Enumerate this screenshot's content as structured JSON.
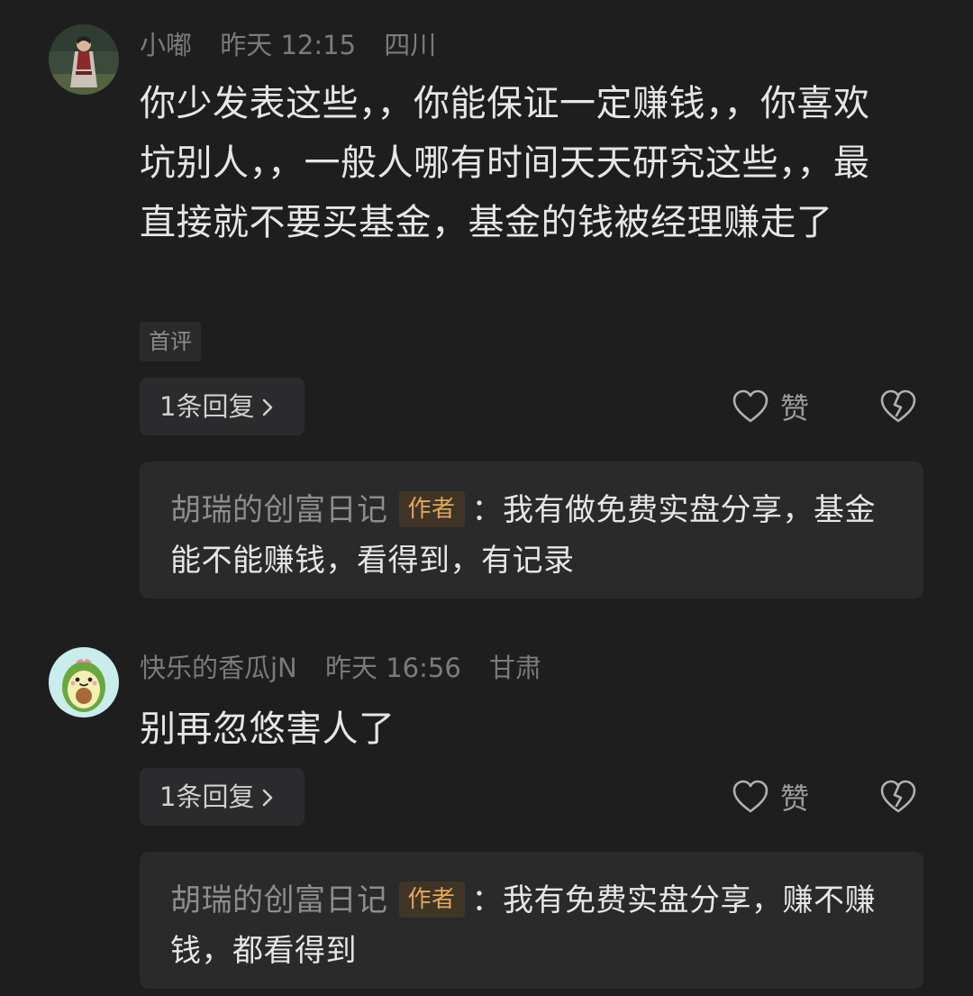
{
  "comments": [
    {
      "avatar_icon": "avatar-user-portrait",
      "username": "小嘟",
      "time": "昨天 12:15",
      "location": "四川",
      "text": "你少发表这些，，你能保证一定赚钱，，你喜欢坑别人，，一般人哪有时间天天研究这些，，最直接就不要买基金，基金的钱被经理赚走了",
      "first_tag": "首评",
      "reply_count_label": "1条回复",
      "like_label": "赞",
      "reply": {
        "author": "胡瑞的创富日记",
        "badge": "作者",
        "text": "：我有做免费实盘分享，基金能不能赚钱，看得到，有记录"
      }
    },
    {
      "avatar_icon": "avatar-avocado",
      "username": "快乐的香瓜jN",
      "time": "昨天 16:56",
      "location": "甘肃",
      "text": "别再忽悠害人了",
      "reply_count_label": "1条回复",
      "like_label": "赞",
      "reply": {
        "author": "胡瑞的创富日记",
        "badge": "作者",
        "text": "：我有免费实盘分享，赚不赚钱，都看得到"
      }
    }
  ],
  "icons": {
    "like": "heart-outline-icon",
    "dislike": "broken-heart-icon",
    "chevron": "chevron-right-icon"
  },
  "colors": {
    "background": "#1e1e1f",
    "card": "#2a2a2b",
    "badge_text": "#e1a75a",
    "badge_bg": "#3f3426"
  }
}
